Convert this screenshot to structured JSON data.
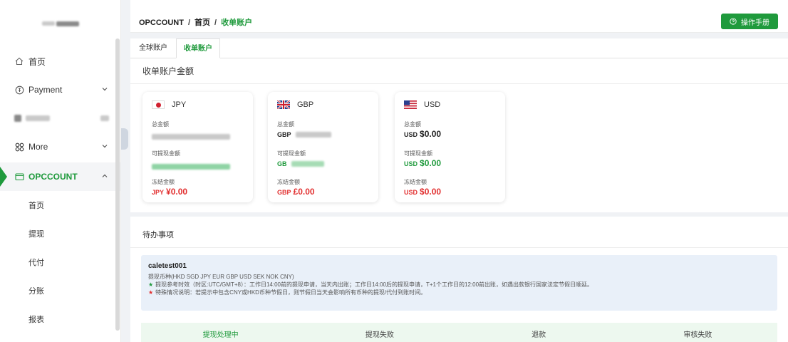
{
  "header": {
    "breadcrumb": [
      "OPCCOUNT",
      "首页",
      "收单账户"
    ],
    "manual_button": "操作手册"
  },
  "sidebar": {
    "home": "首页",
    "payment": "Payment",
    "more": "More",
    "opccount": "OPCCOUNT",
    "sub_items": [
      "首页",
      "提现",
      "代付",
      "分账",
      "报表"
    ]
  },
  "tabs": [
    "全球账户",
    "收单账户"
  ],
  "active_tab": "收单账户",
  "section_title": "收单账户金额",
  "cards": [
    {
      "currency": "JPY",
      "total_label": "总金额",
      "withdrawable_label": "可提现金额",
      "frozen_label": "冻结金额",
      "frozen_currency": "JPY",
      "frozen_value": "¥0.00"
    },
    {
      "currency": "GBP",
      "total_label": "总金额",
      "total_currency": "GBP",
      "withdrawable_label": "可提现金额",
      "withdrawable_currency": "GB",
      "frozen_label": "冻结金额",
      "frozen_currency": "GBP",
      "frozen_value": "£0.00"
    },
    {
      "currency": "USD",
      "total_label": "总金额",
      "total_currency": "USD",
      "total_value": "$0.00",
      "withdrawable_label": "可提现金额",
      "withdrawable_currency": "USD",
      "withdrawable_value": "$0.00",
      "frozen_label": "冻结金额",
      "frozen_currency": "USD",
      "frozen_value": "$0.00"
    }
  ],
  "todo": {
    "title": "待办事项",
    "account_name": "caletest001",
    "currencies_line": "提现币种(HKD SGD JPY EUR GBP USD SEK NOK CNY)",
    "note1": "提现参考时效（时区:UTC/GMT+8）：工作日14:00前的提现申请，当天内出账；工作日14:00后的提现申请，T+1个工作日的12:00前出账，如遇出款银行国家法定节假日顺延。",
    "note2": "特殊情况说明：若提示中包含CNY或HKD币种节假日，则节假日当天会影响所有币种的提现/代付到账时间。",
    "statuses": [
      "提现处理中",
      "提现失败",
      "退款",
      "审核失败"
    ]
  },
  "colors": {
    "brand_green": "#1f9a3c",
    "danger_red": "#e23030",
    "info_bg": "#e9f0f9"
  }
}
